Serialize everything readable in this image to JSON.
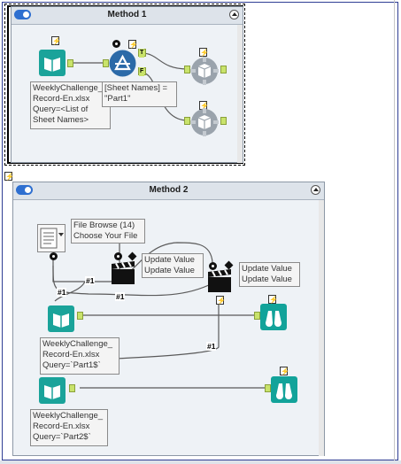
{
  "containers": [
    {
      "title": "Method 1"
    },
    {
      "title": "Method 2"
    }
  ],
  "annotations": {
    "m1_input": "WeeklyChallenge_\nRecord-En.xlsx\nQuery=<List of\nSheet Names>",
    "m1_filter": "[Sheet Names] =\n\"Part1\"",
    "file_browse": "File Browse (14)\nChoose Your File",
    "update_value_1": "Update Value\nUpdate Value",
    "update_value_2": "Update Value\nUpdate Value",
    "m2_input_1": "WeeklyChallenge_\nRecord-En.xlsx\nQuery=`Part1$`",
    "m2_input_2": "WeeklyChallenge_\nRecord-En.xlsx\nQuery=`Part2$`"
  },
  "tags": {
    "hash1": "#1",
    "filter_true": "T",
    "filter_false": "F"
  },
  "colors": {
    "input_tool": "#1aa39a",
    "filter_tool": "#2b6aa8",
    "macro_tool": "#9aa3ac",
    "browse_tool": "#12a39a",
    "accent": "#2e6fd0"
  },
  "icons": {
    "input": "book-icon",
    "filter": "filter-triangle-icon",
    "macro_output": "gear-box-icon",
    "file_browse": "file-browse-icon",
    "action": "clapperboard-icon",
    "browse": "binoculars-icon",
    "bolt": "lightning-bolt-icon"
  }
}
